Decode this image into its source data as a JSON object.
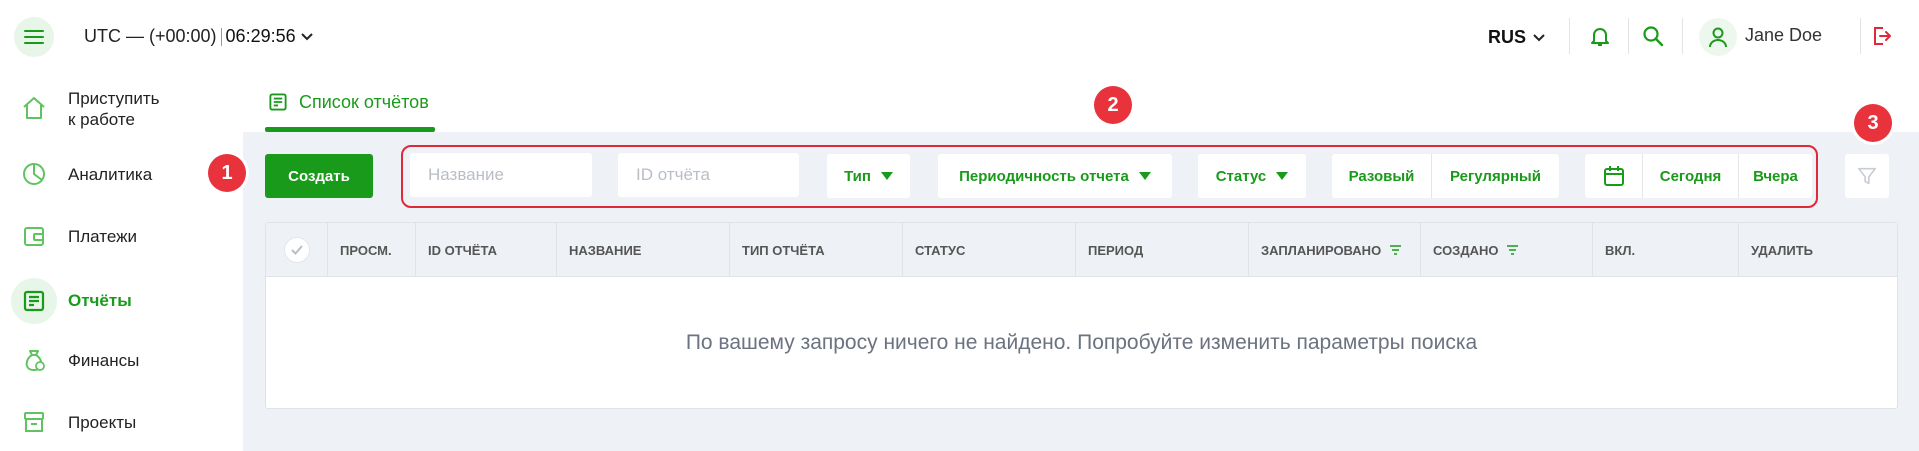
{
  "header": {
    "timezone": "UTC — (+00:00)",
    "time": "06:29:56",
    "language": "RUS",
    "user_name": "Jane Doe"
  },
  "sidebar": {
    "items": [
      {
        "label": "Приступить\nк работе",
        "icon": "home-icon",
        "active": false
      },
      {
        "label": "Аналитика",
        "icon": "pie-chart-icon",
        "active": false
      },
      {
        "label": "Платежи",
        "icon": "wallet-icon",
        "active": false
      },
      {
        "label": "Отчёты",
        "icon": "report-icon",
        "active": true
      },
      {
        "label": "Финансы",
        "icon": "money-bag-icon",
        "active": false
      },
      {
        "label": "Проекты",
        "icon": "archive-icon",
        "active": false
      }
    ]
  },
  "main": {
    "tab_label": "Список отчётов",
    "create_button": "Создать",
    "filters": {
      "name_placeholder": "Название",
      "id_placeholder": "ID отчёта",
      "type_label": "Тип",
      "periodicity_label": "Периодичность отчета",
      "status_label": "Статус",
      "one_time_label": "Разовый",
      "regular_label": "Регулярный",
      "today_label": "Сегодня",
      "yesterday_label": "Вчера"
    },
    "table": {
      "columns": [
        "Просм.",
        "ID отчёта",
        "Название",
        "Тип отчёта",
        "Статус",
        "Период",
        "Запланировано",
        "Создано",
        "Вкл.",
        "Удалить"
      ],
      "empty_message": "По вашему запросу ничего не найдено. Попробуйте изменить параметры поиска"
    }
  },
  "annotations": [
    "1",
    "2",
    "3"
  ],
  "colors": {
    "accent": "#1a9a1a",
    "badge": "#e8323c",
    "background": "#eef1f5"
  }
}
